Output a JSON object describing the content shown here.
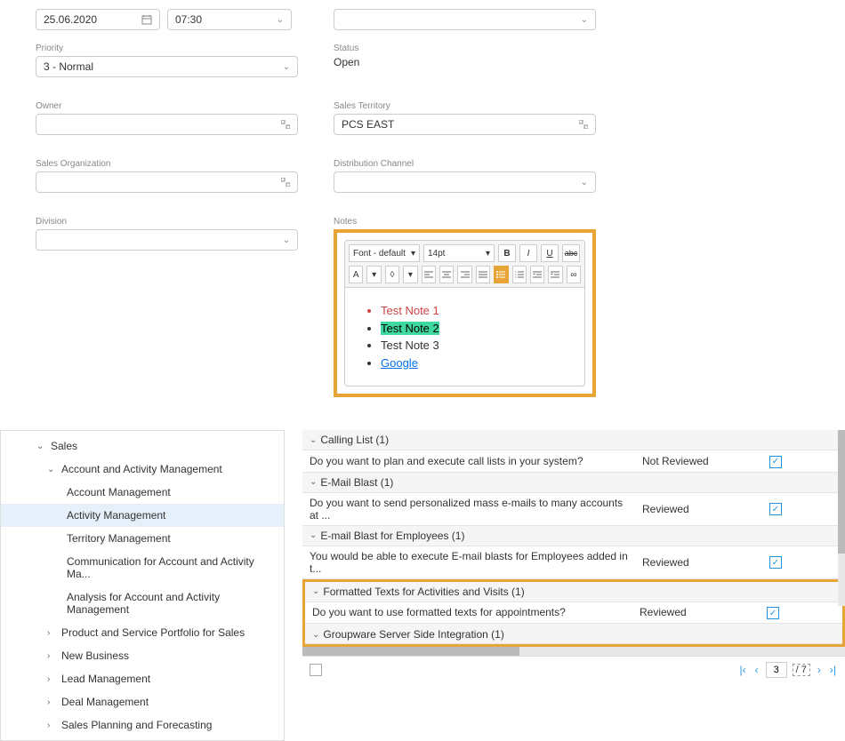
{
  "form": {
    "date": "25.06.2020",
    "time": "07:30",
    "priority_label": "Priority",
    "priority_value": "3 - Normal",
    "owner_label": "Owner",
    "owner_value": "",
    "sales_org_label": "Sales Organization",
    "sales_org_value": "",
    "division_label": "Division",
    "division_value": "",
    "status_label": "Status",
    "status_value": "Open",
    "sales_territory_label": "Sales Territory",
    "sales_territory_value": "PCS EAST",
    "dist_channel_label": "Distribution Channel",
    "dist_channel_value": "",
    "notes_label": "Notes"
  },
  "editor": {
    "font_name": "Font - default",
    "font_size": "14pt",
    "buttons": {
      "bold": "B",
      "italic": "I",
      "underline": "U",
      "strike": "abc",
      "text_color": "A",
      "highlight": "◊",
      "link": "∞"
    },
    "notes": [
      {
        "text": "Test Note 1",
        "style": "red"
      },
      {
        "text": "Test Note 2",
        "style": "green-bg"
      },
      {
        "text": "Test Note 3",
        "style": "normal"
      },
      {
        "text": "Google",
        "style": "link"
      }
    ]
  },
  "tree": {
    "items": [
      {
        "label": "Sales",
        "level": 0,
        "expanded": true
      },
      {
        "label": "Account and Activity Management",
        "level": 1,
        "expanded": true
      },
      {
        "label": "Account Management",
        "level": 2
      },
      {
        "label": "Activity Management",
        "level": 2,
        "selected": true
      },
      {
        "label": "Territory Management",
        "level": 2
      },
      {
        "label": "Communication for Account and Activity Ma...",
        "level": 2
      },
      {
        "label": "Analysis for Account and Activity Management",
        "level": 2
      },
      {
        "label": "Product and Service Portfolio for Sales",
        "level": 1,
        "collapsed": true
      },
      {
        "label": "New Business",
        "level": 1,
        "collapsed": true
      },
      {
        "label": "Lead Management",
        "level": 1,
        "collapsed": true
      },
      {
        "label": "Deal Management",
        "level": 1,
        "collapsed": true
      },
      {
        "label": "Sales Planning and Forecasting",
        "level": 1,
        "collapsed": true
      }
    ]
  },
  "table": {
    "groups": [
      {
        "header": "Calling List (1)",
        "rows": [
          {
            "question": "Do you want to plan and execute call lists in your system?",
            "status": "Not Reviewed",
            "checked": true
          }
        ]
      },
      {
        "header": "E-Mail Blast (1)",
        "rows": [
          {
            "question": "Do you want to send personalized mass e-mails to many accounts at ...",
            "status": "Reviewed",
            "checked": true
          }
        ]
      },
      {
        "header": "E-mail Blast for Employees (1)",
        "rows": [
          {
            "question": "You would be able to execute E-mail blasts for Employees added in t...",
            "status": "Reviewed",
            "checked": true
          }
        ]
      },
      {
        "header": "Formatted Texts for Activities and Visits (1)",
        "highlighted": true,
        "rows": [
          {
            "question": "Do you want to use formatted texts for appointments?",
            "status": "Reviewed",
            "checked": true
          }
        ],
        "footer_row": "Groupware Server Side Integration (1)"
      }
    ],
    "pagination": {
      "current": "3",
      "total": "/ 7"
    }
  }
}
